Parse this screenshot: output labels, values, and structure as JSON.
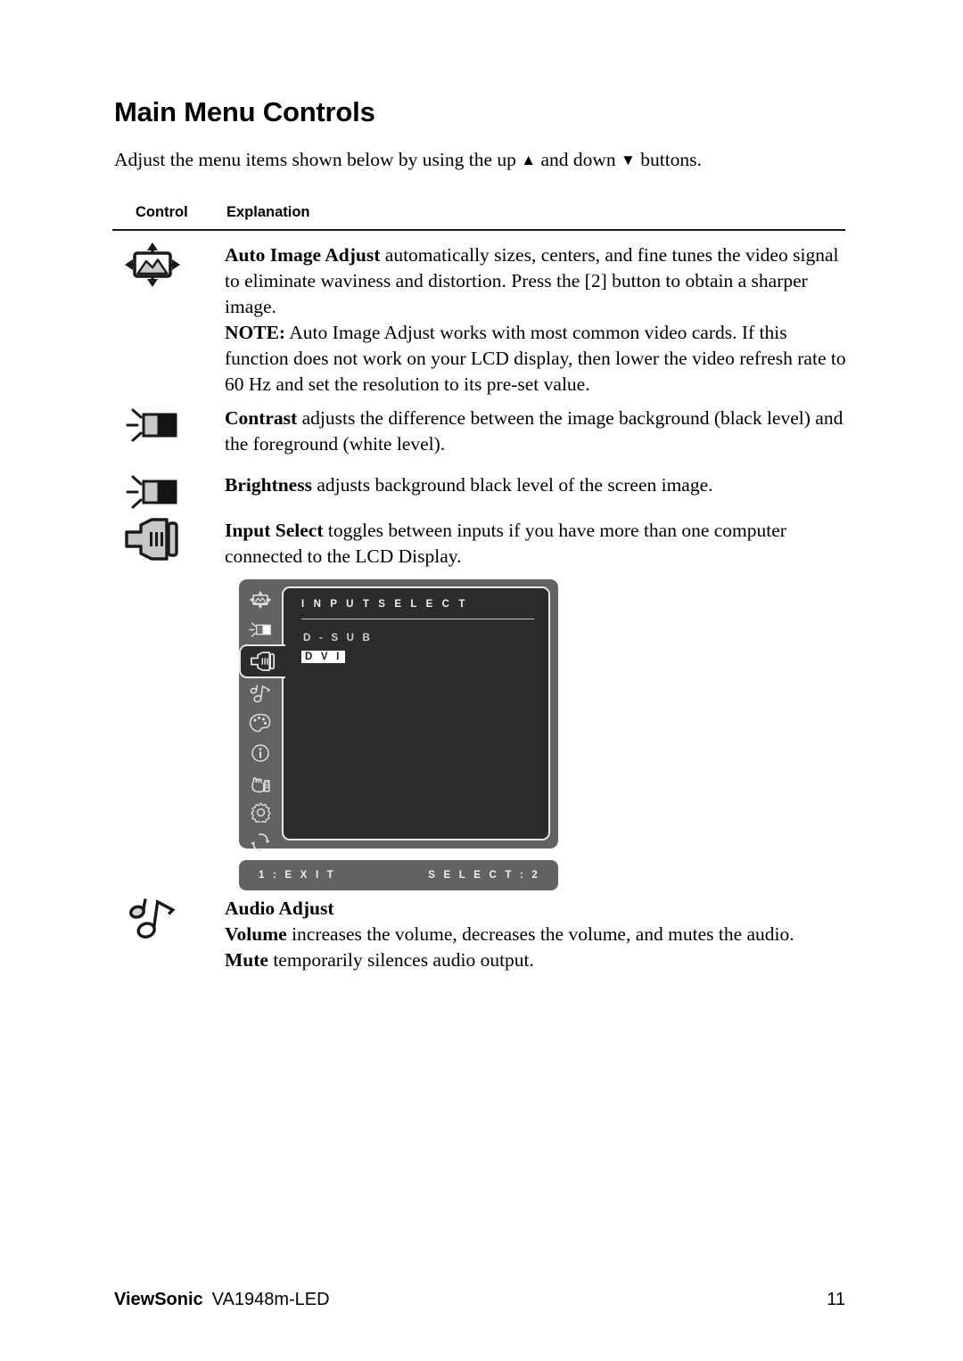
{
  "document": {
    "title": "Main Menu Controls",
    "intro_before": "Adjust the menu items shown below by using the up ",
    "intro_up_glyph": "▲",
    "intro_middle": " and down ",
    "intro_down_glyph": "▼",
    "intro_after": " buttons."
  },
  "table": {
    "col_control": "Control",
    "col_explanation": "Explanation"
  },
  "rows": {
    "auto_image_adjust": {
      "icon": "auto-image-adjust-icon",
      "term": "Auto Image Adjust",
      "body": " automatically sizes, centers, and fine tunes the video signal to eliminate waviness and distortion. Press the [2] button to obtain a sharper image.",
      "note_label": "NOTE:",
      "note_body": " Auto Image Adjust works with most common video cards. If this function does not work on your LCD display, then lower the video refresh rate to 60 Hz and set the resolution to its pre-set value."
    },
    "contrast": {
      "icon": "contrast-icon",
      "term": "Contrast",
      "body": " adjusts the difference between the image background  (black level) and the foreground (white level)."
    },
    "brightness": {
      "icon": "brightness-icon",
      "term": "Brightness",
      "body": " adjusts background black level of the screen image."
    },
    "input_select": {
      "icon": "input-select-icon",
      "term": "Input Select",
      "body": " toggles between inputs if you have more than one computer connected to the LCD Display."
    },
    "audio_adjust": {
      "icon": "audio-adjust-icon",
      "heading": "Audio Adjust",
      "volume_term": "Volume",
      "volume_body": " increases the volume, decreases the volume, and mutes the audio.",
      "mute_term": "Mute",
      "mute_body": " temporarily silences audio output."
    }
  },
  "osd": {
    "title": "I N P U T   S E L E C T",
    "options": [
      {
        "label": "D - S U B",
        "selected": false
      },
      {
        "label": "D V I",
        "selected": true
      }
    ],
    "footer_left": "1 : E X I T",
    "footer_right": "S E L E C T : 2",
    "sidebar_icons": [
      "auto-image-adjust-icon",
      "contrast-brightness-icon",
      "input-select-icon",
      "audio-adjust-icon",
      "color-adjust-icon",
      "information-icon",
      "manual-image-adjust-icon",
      "setup-menu-icon",
      "memory-recall-icon"
    ],
    "active_index": 2,
    "colors": {
      "rail": "#626262",
      "body": "#2c2c2c",
      "highlight": "#ffffff",
      "text": "#f0f0f0"
    }
  },
  "footer": {
    "brand": "ViewSonic",
    "model": "VA1948m-LED",
    "page_number": "11"
  }
}
